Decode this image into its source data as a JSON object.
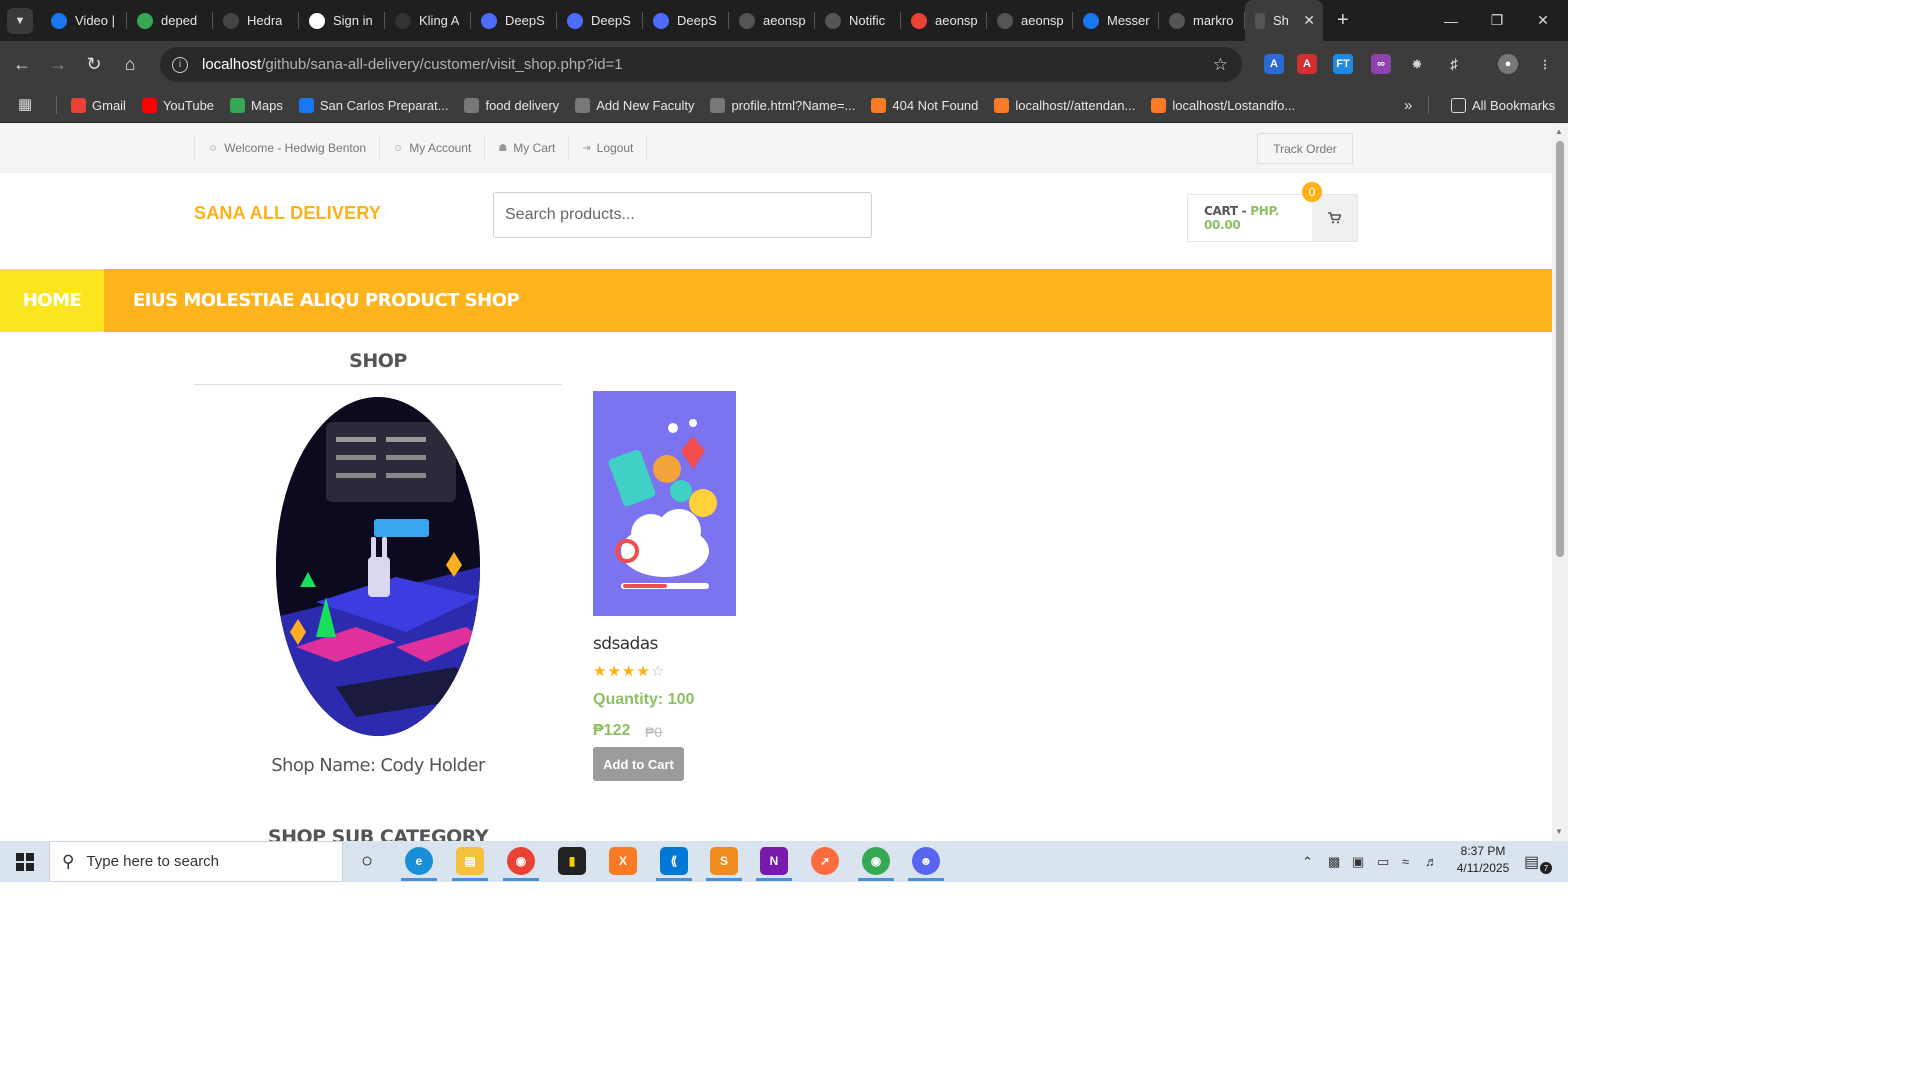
{
  "browser": {
    "tabs": [
      {
        "label": "Video |",
        "icon": "facebook-icon",
        "color": "#1877f2"
      },
      {
        "label": "deped",
        "icon": "google-drive-icon",
        "color": "#34a853"
      },
      {
        "label": "Hedra",
        "icon": "hedra-icon",
        "color": "#444444"
      },
      {
        "label": "Sign in",
        "icon": "google-icon",
        "color": "#ffffff"
      },
      {
        "label": "Kling A",
        "icon": "kling-icon",
        "color": "#333333"
      },
      {
        "label": "DeepS",
        "icon": "deepseek-icon",
        "color": "#4d6bfe"
      },
      {
        "label": "DeepS",
        "icon": "deepseek-icon",
        "color": "#4d6bfe"
      },
      {
        "label": "DeepS",
        "icon": "deepseek-icon",
        "color": "#4d6bfe"
      },
      {
        "label": "aeonsp",
        "icon": "github-icon",
        "color": "#555555"
      },
      {
        "label": "Notific",
        "icon": "github-icon",
        "color": "#555555"
      },
      {
        "label": "aeonsp",
        "icon": "gmail-icon",
        "color": "#ea4335"
      },
      {
        "label": "aeonsp",
        "icon": "github-icon",
        "color": "#555555"
      },
      {
        "label": "Messer",
        "icon": "facebook-icon",
        "color": "#1877f2"
      },
      {
        "label": "markro",
        "icon": "github-icon",
        "color": "#555555"
      }
    ],
    "active_tab": {
      "label": "Sh",
      "icon": "page-icon"
    },
    "url_host": "localhost",
    "url_path": "/github/sana-all-delivery/customer/visit_shop.php?id=1",
    "bookmarks": [
      {
        "label": "Gmail",
        "icon": "gmail-icon",
        "color": "#ea4335"
      },
      {
        "label": "YouTube",
        "icon": "youtube-icon",
        "color": "#ff0000"
      },
      {
        "label": "Maps",
        "icon": "maps-icon",
        "color": "#34a853"
      },
      {
        "label": "San Carlos Preparat...",
        "icon": "facebook-icon",
        "color": "#1877f2"
      },
      {
        "label": "food delivery",
        "icon": "globe-icon",
        "color": "#777777"
      },
      {
        "label": "Add New Faculty",
        "icon": "globe-icon",
        "color": "#777777"
      },
      {
        "label": "profile.html?Name=...",
        "icon": "globe-icon",
        "color": "#777777"
      },
      {
        "label": "404 Not Found",
        "icon": "xampp-icon",
        "color": "#fb7a24"
      },
      {
        "label": "localhost//attendan...",
        "icon": "xampp-icon",
        "color": "#fb7a24"
      },
      {
        "label": "localhost/Lostandfo...",
        "icon": "xampp-icon",
        "color": "#fb7a24"
      }
    ],
    "all_bookmarks_label": "All Bookmarks"
  },
  "header": {
    "top_links": [
      {
        "label": "Welcome - Hedwig Benton",
        "icon": "user-icon"
      },
      {
        "label": "My Account",
        "icon": "user-icon"
      },
      {
        "label": "My Cart",
        "icon": "cart-icon"
      },
      {
        "label": "Logout",
        "icon": "logout-icon"
      }
    ],
    "track_order": "Track Order",
    "brand": "SANA ALL DELIVERY",
    "search_placeholder": "Search products...",
    "cart_label": "CART - ",
    "cart_amount": "PHP. 00.00",
    "cart_count": "0"
  },
  "nav": {
    "home": "HOME",
    "shop": "EIUS MOLESTIAE ALIQU PRODUCT SHOP"
  },
  "sidebar": {
    "title": "SHOP",
    "shop_name": "Shop Name: Cody Holder",
    "sub_category": "SHOP SUB CATEGORY"
  },
  "product": {
    "name": "sdsadas",
    "rating": 4,
    "rating_max": 5,
    "quantity": "Quantity: 100",
    "price": "₱122",
    "old_price": "₱0",
    "add_button": "Add to Cart"
  },
  "taskbar": {
    "search_placeholder": "Type here to search",
    "time": "8:37 PM",
    "date": "4/11/2025",
    "notification_count": "7"
  },
  "colors": {
    "accent": "#fdb41d",
    "home_tab": "#fbe51f",
    "green": "#8cc063"
  }
}
